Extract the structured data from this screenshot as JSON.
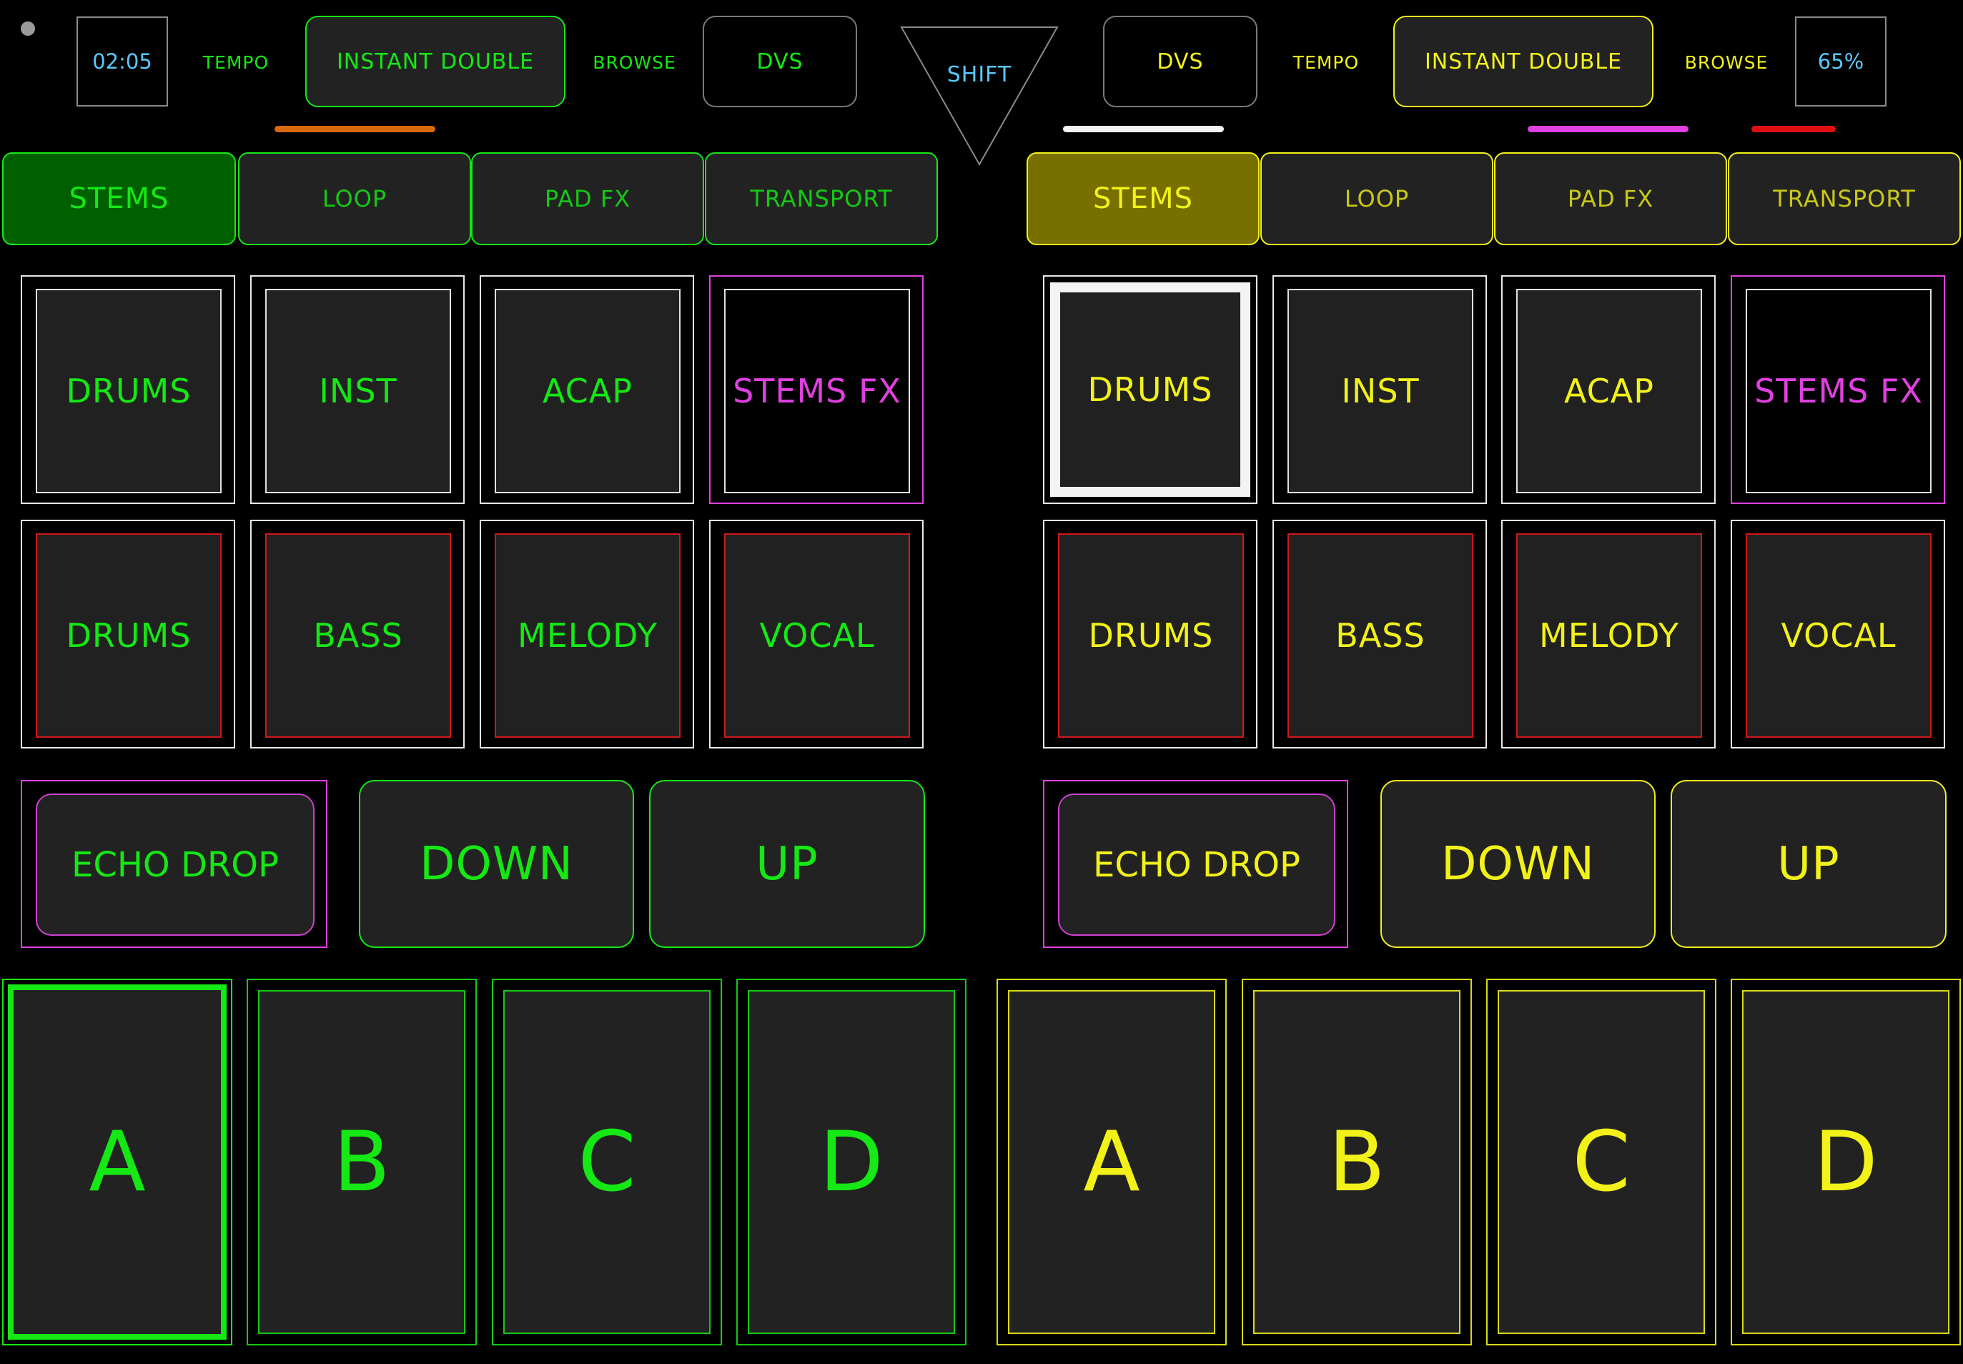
{
  "colors": {
    "left": "#15e815",
    "right": "#f2f21a",
    "fx": "#e040e0",
    "clock": "#5ac8fa"
  },
  "top": {
    "time": "02:05",
    "left": {
      "tempo": "TEMPO",
      "instant": "INSTANT DOUBLE",
      "browse": "BROWSE",
      "dvs": "DVS"
    },
    "shift": "SHIFT",
    "right": {
      "dvs": "DVS",
      "tempo": "TEMPO",
      "instant": "INSTANT DOUBLE",
      "browse": "BROWSE"
    },
    "percent": "65%"
  },
  "left_tabs": [
    "STEMS",
    "LOOP",
    "PAD FX",
    "TRANSPORT"
  ],
  "right_tabs": [
    "STEMS",
    "LOOP",
    "PAD FX",
    "TRANSPORT"
  ],
  "left_row1": [
    "DRUMS",
    "INST",
    "ACAP",
    "STEMS FX"
  ],
  "left_row2": [
    "DRUMS",
    "BASS",
    "MELODY",
    "VOCAL"
  ],
  "right_row1": [
    "DRUMS",
    "INST",
    "ACAP",
    "STEMS FX"
  ],
  "right_row2": [
    "DRUMS",
    "BASS",
    "MELODY",
    "VOCAL"
  ],
  "left_controls": {
    "echo": "ECHO DROP",
    "down": "DOWN",
    "up": "UP"
  },
  "right_controls": {
    "echo": "ECHO DROP",
    "down": "DOWN",
    "up": "UP"
  },
  "left_hotcues": [
    "A",
    "B",
    "C",
    "D"
  ],
  "right_hotcues": [
    "A",
    "B",
    "C",
    "D"
  ]
}
